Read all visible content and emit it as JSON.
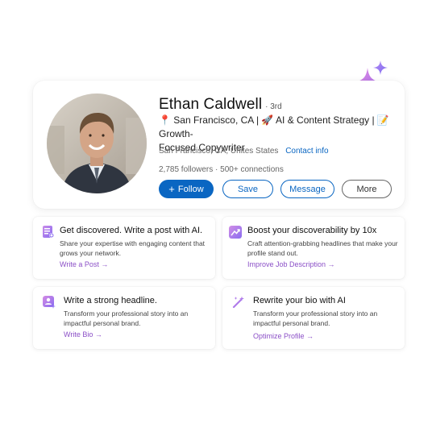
{
  "profile": {
    "name": "Ethan Caldwell",
    "degree": "· 3rd",
    "headline_line1": "📍 San Francisco, CA | 🚀 AI & Content Strategy | 📝 Growth-",
    "headline_line2": "Focused Copywriter",
    "location": "San Francisco, CA, Unites States",
    "contact_link": "Contact info",
    "stats": "2,785 followers  · 500+ connections"
  },
  "actions": {
    "follow": "Follow",
    "save": "Save",
    "message": "Message",
    "more": "More"
  },
  "tips": [
    {
      "title": "Get discovered. Write a post with AI.",
      "desc_line1": "Share your expertise with engaging content that",
      "desc_line2": "grows your network.",
      "link": "Write a Post →",
      "icon": "document-icon"
    },
    {
      "title": "Boost your discoverability by 10x",
      "desc_line1": "Craft attention-grabbing headlines that make your",
      "desc_line2": "profile stand out.",
      "link": "Improve Job Description →",
      "icon": "trend-chart-icon"
    },
    {
      "title": "Write a strong headline.",
      "desc_line1": "Transform your professional story into an",
      "desc_line2": "impactful personal brand.",
      "link": "Write Bio →",
      "icon": "person-sparkle-icon"
    },
    {
      "title": "Rewrite your bio with AI",
      "desc_line1": "Transform your professional story into an",
      "desc_line2": "impactful personal brand.",
      "link": "Optimize Profile →",
      "icon": "magic-wand-icon"
    }
  ],
  "colors": {
    "primary_blue": "#0a66c2",
    "ai_purple": "#8b4fc7",
    "sparkle_gradient_start": "#c77be8",
    "sparkle_gradient_end": "#8a6cf0"
  }
}
